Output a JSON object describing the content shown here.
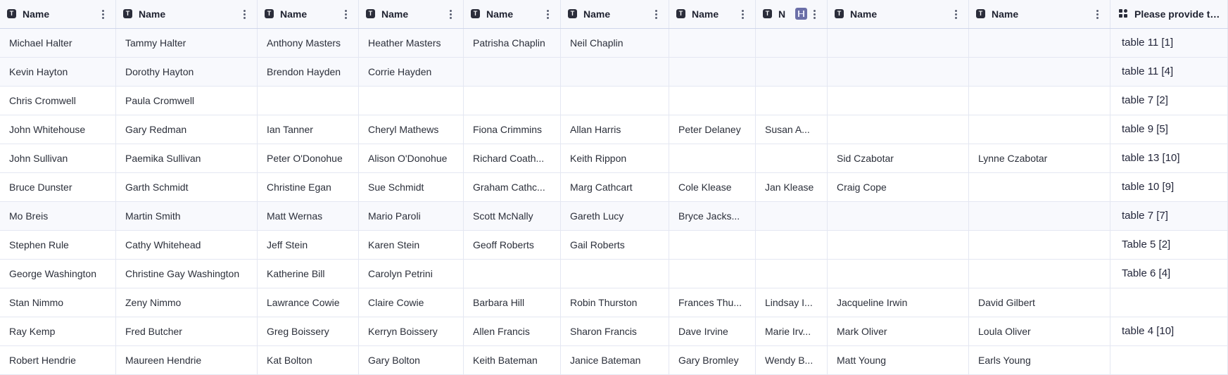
{
  "columns": [
    {
      "label": "Name",
      "icon": "text-type-icon"
    },
    {
      "label": "Name",
      "icon": "text-type-icon"
    },
    {
      "label": "Name",
      "icon": "text-type-icon"
    },
    {
      "label": "Name",
      "icon": "text-type-icon"
    },
    {
      "label": "Name",
      "icon": "text-type-icon"
    },
    {
      "label": "Name",
      "icon": "text-type-icon"
    },
    {
      "label": "Name",
      "icon": "text-type-icon"
    },
    {
      "label": "N",
      "icon": "text-type-icon"
    },
    {
      "label": "Name",
      "icon": "text-type-icon"
    },
    {
      "label": "Name",
      "icon": "text-type-icon"
    },
    {
      "label": "Please provide th...",
      "icon": "category-icon"
    }
  ],
  "rows": [
    [
      "Michael Halter",
      "Tammy Halter",
      "Anthony Masters",
      "Heather Masters",
      "Patrisha Chaplin",
      "Neil Chaplin",
      "",
      "",
      "",
      "",
      "table 11 [1]"
    ],
    [
      "Kevin Hayton",
      "Dorothy Hayton",
      "Brendon Hayden",
      "Corrie Hayden",
      "",
      "",
      "",
      "",
      "",
      "",
      "table 11 [4]"
    ],
    [
      "Chris Cromwell",
      "Paula Cromwell",
      "",
      "",
      "",
      "",
      "",
      "",
      "",
      "",
      "table 7 [2]"
    ],
    [
      "John Whitehouse",
      "Gary Redman",
      "Ian Tanner",
      "Cheryl Mathews",
      "Fiona Crimmins",
      "Allan Harris",
      "Peter Delaney",
      "Susan A...",
      "",
      "",
      "table 9 [5]"
    ],
    [
      "John Sullivan",
      "Paemika Sullivan",
      "Peter O'Donohue",
      "Alison O'Donohue",
      "Richard Coath...",
      "Keith Rippon",
      "",
      "",
      "Sid Czabotar",
      "Lynne Czabotar",
      "table 13 [10]"
    ],
    [
      "Bruce Dunster",
      "Garth Schmidt",
      "Christine Egan",
      "Sue Schmidt",
      "Graham Cathc...",
      "Marg Cathcart",
      "Cole Klease",
      "Jan Klease",
      "Craig Cope",
      "",
      "table 10 [9]"
    ],
    [
      "Mo Breis",
      "Martin Smith",
      "Matt Wernas",
      "Mario Paroli",
      "Scott McNally",
      "Gareth Lucy",
      "Bryce Jacks...",
      "",
      "",
      "",
      "table 7 [7]"
    ],
    [
      "Stephen Rule",
      "Cathy Whitehead",
      "Jeff Stein",
      "Karen Stein",
      "Geoff Roberts",
      "Gail Roberts",
      "",
      "",
      "",
      "",
      "Table 5 [2]"
    ],
    [
      "George Washington",
      "Christine Gay Washington",
      "Katherine Bill",
      "Carolyn Petrini",
      "",
      "",
      "",
      "",
      "",
      "",
      "Table 6 [4]"
    ],
    [
      "Stan Nimmo",
      "Zeny Nimmo",
      "Lawrance Cowie",
      "Claire Cowie",
      "Barbara Hill",
      "Robin Thurston",
      "Frances Thu...",
      "Lindsay I...",
      "Jacqueline Irwin",
      "David Gilbert",
      ""
    ],
    [
      "Ray Kemp",
      "Fred Butcher",
      "Greg Boissery",
      "Kerryn Boissery",
      "Allen Francis",
      "Sharon Francis",
      "Dave Irvine",
      "Marie Irv...",
      "Mark Oliver",
      "Loula Oliver",
      "table 4 [10]"
    ],
    [
      "Robert Hendrie",
      "Maureen Hendrie",
      "Kat Bolton",
      "Gary Bolton",
      "Keith Bateman",
      "Janice Bateman",
      "Gary Bromley",
      "Wendy B...",
      "Matt Young",
      "Earls Young",
      ""
    ]
  ]
}
